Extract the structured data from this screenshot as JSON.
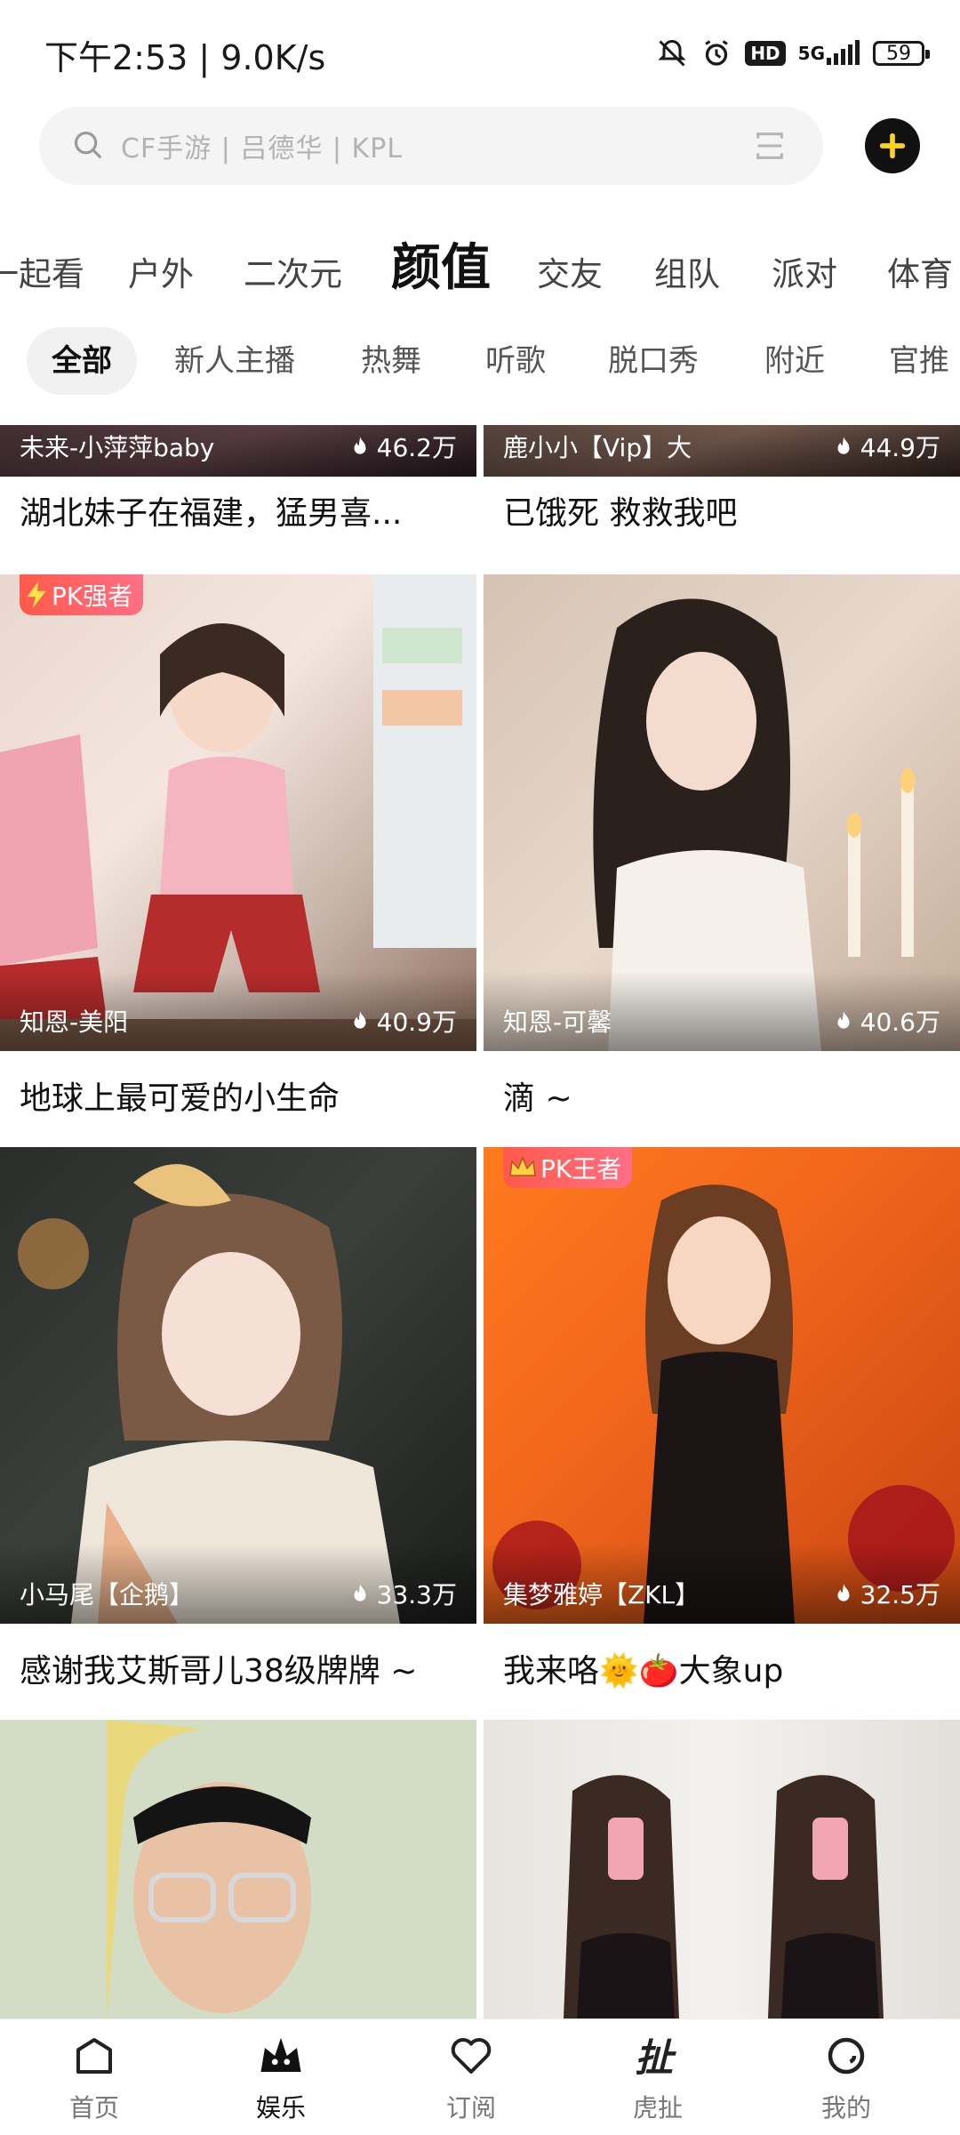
{
  "status_bar": {
    "time": "下午2:53 | 9.0K/s",
    "hd": "HD",
    "network": "5G",
    "battery": "59"
  },
  "search": {
    "placeholder": "CF手游 | 吕德华 | KPL"
  },
  "category_tabs": [
    {
      "label": "一起看"
    },
    {
      "label": "户外"
    },
    {
      "label": "二次元"
    },
    {
      "label": "颜值",
      "active": true
    },
    {
      "label": "交友"
    },
    {
      "label": "组队"
    },
    {
      "label": "派对"
    },
    {
      "label": "体育"
    }
  ],
  "sub_tabs": [
    {
      "label": "全部",
      "active": true
    },
    {
      "label": "新人主播"
    },
    {
      "label": "热舞"
    },
    {
      "label": "听歌"
    },
    {
      "label": "脱口秀"
    },
    {
      "label": "附近"
    },
    {
      "label": "官推"
    }
  ],
  "cards": [
    {
      "anchor": "未来-小萍萍baby",
      "viewers": "46.2万",
      "title": "湖北妹子在福建，猛男喜..."
    },
    {
      "anchor": "鹿小小【Vip】大",
      "viewers": "44.9万",
      "title": "已饿死 救救我吧"
    },
    {
      "anchor": "知恩-美阳",
      "viewers": "40.9万",
      "title": "地球上最可爱的小生命",
      "badge": "PK强者"
    },
    {
      "anchor": "知恩-可馨",
      "viewers": "40.6万",
      "title": "滴 ~"
    },
    {
      "anchor": "小马尾【企鹅】",
      "viewers": "33.3万",
      "title": "感谢我艾斯哥儿38级牌牌 ~"
    },
    {
      "anchor": "集梦雅婷【ZKL】",
      "viewers": "32.5万",
      "title": "我来咯🌞🍅大象up",
      "badge": "PK王者"
    },
    {
      "anchor": "",
      "viewers": "",
      "title": ""
    },
    {
      "anchor": "",
      "viewers": "",
      "title": ""
    }
  ],
  "bottom_nav": [
    {
      "label": "首页",
      "icon": "home-icon"
    },
    {
      "label": "娱乐",
      "icon": "entertainment-icon",
      "active": true
    },
    {
      "label": "订阅",
      "icon": "heart-icon"
    },
    {
      "label": "虎扯",
      "icon": "huche-icon"
    },
    {
      "label": "我的",
      "icon": "profile-icon"
    }
  ]
}
